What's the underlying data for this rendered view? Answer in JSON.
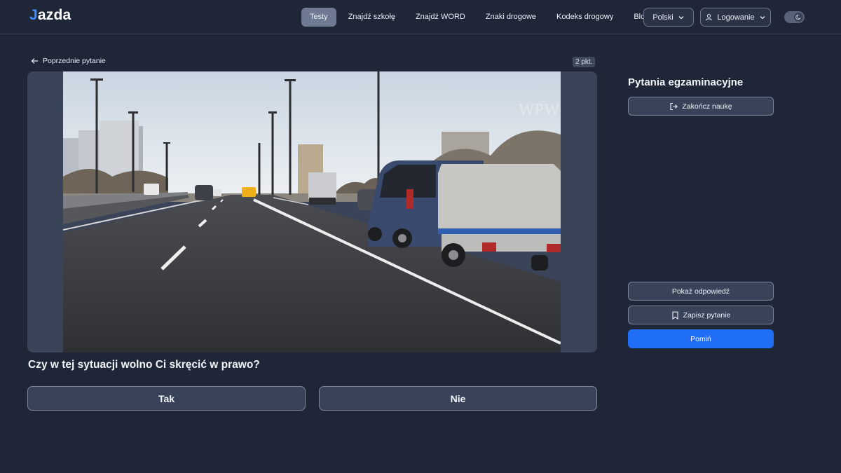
{
  "brand": {
    "logo_first": "J",
    "logo_rest": "azda"
  },
  "nav": {
    "items": [
      {
        "label": "Testy",
        "active": true
      },
      {
        "label": "Znajdź szkołę",
        "active": false
      },
      {
        "label": "Znajdź WORD",
        "active": false
      },
      {
        "label": "Znaki drogowe",
        "active": false
      },
      {
        "label": "Kodeks drogowy",
        "active": false
      },
      {
        "label": "Blog",
        "active": false
      }
    ],
    "language": "Polski",
    "login": "Logowanie",
    "theme_icon": "moon-icon"
  },
  "question": {
    "back_label": "Poprzednie pytanie",
    "points": "2 pkt.",
    "text": "Czy w tej sytuacji wolno Ci skręcić w prawo?",
    "answers": {
      "yes": "Tak",
      "no": "Nie"
    },
    "image_watermark": "WPW"
  },
  "sidebar": {
    "title": "Pytania egzaminacyjne",
    "finish_label": "Zakończ naukę",
    "show_answer_label": "Pokaż odpowiedź",
    "save_label": "Zapisz pytanie",
    "skip_label": "Pomiń"
  },
  "colors": {
    "background": "#1e2638",
    "accent": "#1f6ef5",
    "logo_accent": "#3d8bff"
  }
}
